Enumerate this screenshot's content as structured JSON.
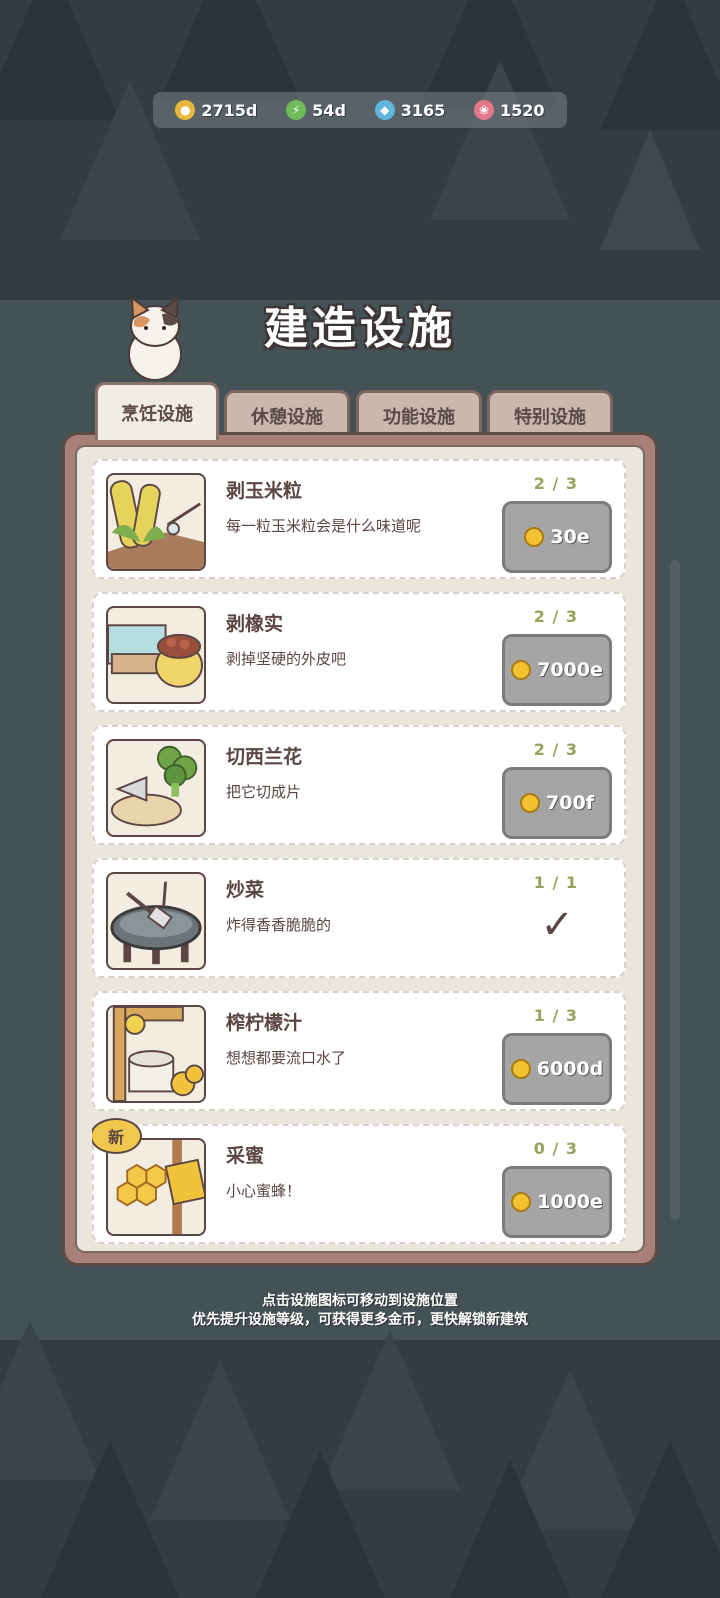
{
  "resources": [
    {
      "icon": "gold-coin-icon",
      "value": "2715d",
      "color": "#e9b73d",
      "glyph": "●"
    },
    {
      "icon": "energy-bolt-icon",
      "value": "54d",
      "color": "#6dbb5a",
      "glyph": "⚡"
    },
    {
      "icon": "diamond-icon",
      "value": "3165",
      "color": "#5fb6dd",
      "glyph": "◆"
    },
    {
      "icon": "heart-shell-icon",
      "value": "1520",
      "color": "#e2788c",
      "glyph": "❀"
    }
  ],
  "title": "建造设施",
  "tabs": [
    {
      "label": "烹饪设施"
    },
    {
      "label": "休憩设施"
    },
    {
      "label": "功能设施"
    },
    {
      "label": "特别设施"
    }
  ],
  "facilities": [
    {
      "name": "剥玉米粒",
      "desc": "每一粒玉米粒会是什么味道呢",
      "count": "2 / 3",
      "price": "30e",
      "done": false,
      "is_new": false
    },
    {
      "name": "剥橡实",
      "desc": "剥掉坚硬的外皮吧",
      "count": "2 / 3",
      "price": "7000e",
      "done": false,
      "is_new": false
    },
    {
      "name": "切西兰花",
      "desc": "把它切成片",
      "count": "2 / 3",
      "price": "700f",
      "done": false,
      "is_new": false
    },
    {
      "name": "炒菜",
      "desc": "炸得香香脆脆的",
      "count": "1 / 1",
      "price": "",
      "done": true,
      "is_new": false
    },
    {
      "name": "榨柠檬汁",
      "desc": "想想都要流口水了",
      "count": "1 / 3",
      "price": "6000d",
      "done": false,
      "is_new": false
    },
    {
      "name": "采蜜",
      "desc": "小心蜜蜂！",
      "count": "0 / 3",
      "price": "1000e",
      "done": false,
      "is_new": true
    }
  ],
  "new_badge": "新",
  "hints": {
    "line1": "点击设施图标可移动到设施位置",
    "line2": "优先提升设施等级，可获得更多金币，更快解锁新建筑"
  },
  "check_glyph": "✓"
}
